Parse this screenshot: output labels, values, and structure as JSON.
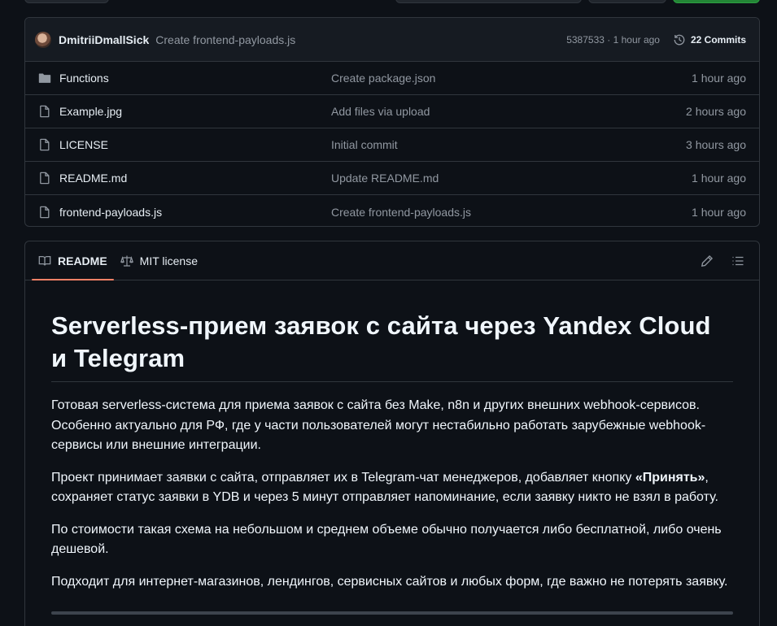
{
  "commit": {
    "author": "DmitriiDmallSick",
    "message": "Create frontend-payloads.js",
    "meta": "5387533 · 1 hour ago",
    "count": "22 Commits"
  },
  "files": [
    {
      "name": "Functions",
      "type": "folder",
      "message": "Create package.json",
      "time": "1 hour ago"
    },
    {
      "name": "Example.jpg",
      "type": "file",
      "message": "Add files via upload",
      "time": "2 hours ago"
    },
    {
      "name": "LICENSE",
      "type": "file",
      "message": "Initial commit",
      "time": "3 hours ago"
    },
    {
      "name": "README.md",
      "type": "file",
      "message": "Update README.md",
      "time": "1 hour ago"
    },
    {
      "name": "frontend-payloads.js",
      "type": "file",
      "message": "Create frontend-payloads.js",
      "time": "1 hour ago"
    }
  ],
  "tabs": {
    "readme": "README",
    "license": "MIT license"
  },
  "readme": {
    "title": "Serverless-прием заявок с сайта через Yandex Cloud и Telegram",
    "p1": "Готовая serverless-система для приема заявок с сайта без Make, n8n и других внешних webhook-сервисов. Особенно актуально для РФ, где у части пользователей могут нестабильно работать зарубежные webhook-сервисы или внешние интеграции.",
    "p2_before": "Проект принимает заявки с сайта, отправляет их в Telegram-чат менеджеров, добавляет кнопку ",
    "p2_bold": "«Принять»",
    "p2_after": ", сохраняет статус заявки в YDB и через 5 минут отправляет напоминание, если заявку никто не взял в работу.",
    "p3": "По стоимости такая схема на небольшом и среднем объеме обычно получается либо бесплатной, либо очень дешевой.",
    "p4": "Подходит для интернет-магазинов, лендингов, сервисных сайтов и любых форм, где важно не потерять заявку."
  },
  "colors": {
    "background": "#0d1117",
    "border": "#30363d",
    "muted": "#9198a1",
    "accent_tab": "#f78166",
    "green_button": "#238636"
  }
}
